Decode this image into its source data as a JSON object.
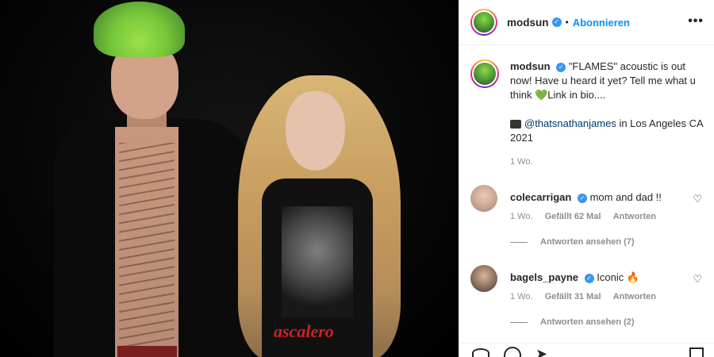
{
  "header": {
    "username": "modsun",
    "separator": "•",
    "follow_label": "Abonnieren",
    "more_label": "•••"
  },
  "caption": {
    "username": "modsun",
    "text": "\"FLAMES\" acoustic is out now! Have u heard it yet? Tell me what u think",
    "emoji": "💚",
    "text_after": "Link in bio....",
    "credit_mention": "@thatsnathanjames",
    "credit_location": "in Los Angeles CA 2021",
    "time": "1 Wo."
  },
  "comments": [
    {
      "username": "colecarrigan",
      "text": "mom and dad !!",
      "time": "1 Wo.",
      "likes": "Gefällt 62 Mal",
      "reply_label": "Antworten",
      "view_replies": "Antworten ansehen (7)"
    },
    {
      "username": "bagels_payne",
      "text": "Iconic",
      "emoji": "🔥",
      "time": "1 Wo.",
      "likes": "Gefällt 31 Mal",
      "reply_label": "Antworten",
      "view_replies": "Antworten ansehen (2)"
    }
  ],
  "photo": {
    "shirt_text": "ascalero"
  },
  "icons": {
    "verified": "verified-badge-icon",
    "like": "heart-icon",
    "comment": "comment-icon",
    "share": "share-icon",
    "save": "bookmark-icon"
  },
  "colors": {
    "accent": "#0095f6",
    "verified": "#3897f0",
    "meta_gray": "#8e8e8e"
  }
}
